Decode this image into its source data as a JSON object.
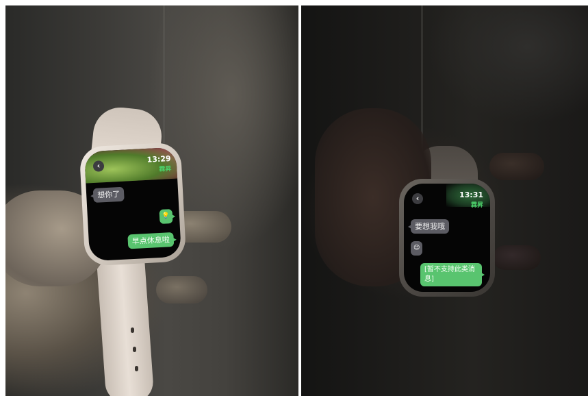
{
  "photos": [
    {
      "clock": "13:29",
      "contact": "霖昇",
      "back_glyph": "‹",
      "messages": [
        {
          "text": "想你了"
        },
        {
          "text": "💡"
        },
        {
          "text": "早点休息啦"
        }
      ]
    },
    {
      "clock": "13:31",
      "contact": "霖昇",
      "back_glyph": "‹",
      "messages": [
        {
          "text": "要想我哦"
        },
        {
          "text": "😊"
        },
        {
          "text": "[暂不支持此类消息]"
        }
      ]
    }
  ],
  "colors": {
    "bubble_received": "#5c5c63",
    "bubble_sent": "#59c46f",
    "contact_name": "#4cd06a",
    "strap_light": "#d9d0c7"
  }
}
